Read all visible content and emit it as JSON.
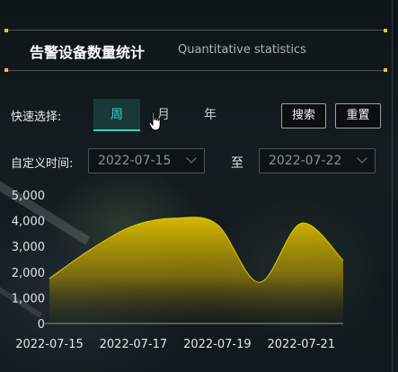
{
  "header": {
    "title": "告警设备数量统计",
    "subtitle": "Quantitative statistics"
  },
  "quick_select": {
    "label": "快速选择:",
    "tabs": [
      {
        "label": "周",
        "active": true
      },
      {
        "label": "月",
        "active": false
      },
      {
        "label": "年",
        "active": false
      }
    ]
  },
  "buttons": {
    "search": "搜索",
    "reset": "重置"
  },
  "custom_time": {
    "label": "自定义时间:",
    "start": "2022-07-15",
    "separator": "至",
    "end": "2022-07-22"
  },
  "colors": {
    "accent": "#38d2c4",
    "area_top": "#d6b800",
    "marker": "#f0c419"
  },
  "chart_data": {
    "type": "area",
    "x": [
      "2022-07-15",
      "2022-07-16",
      "2022-07-17",
      "2022-07-18",
      "2022-07-19",
      "2022-07-20",
      "2022-07-21",
      "2022-07-22"
    ],
    "x_tick_labels": [
      "2022-07-15",
      "2022-07-17",
      "2022-07-19",
      "2022-07-21"
    ],
    "values": [
      1750,
      2900,
      3800,
      4100,
      3850,
      1600,
      3900,
      2450
    ],
    "ylim": [
      0,
      5000
    ],
    "yticks": [
      "0",
      "1,000",
      "2,000",
      "3,000",
      "4,000",
      "5,000"
    ],
    "smooth": true,
    "grid": false
  }
}
